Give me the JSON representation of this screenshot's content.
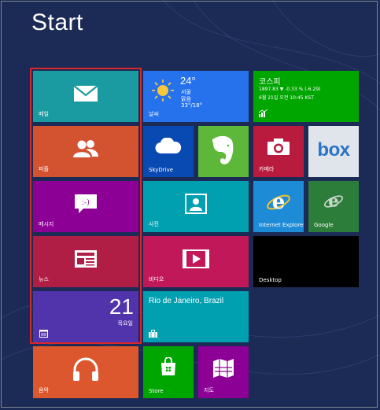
{
  "screen": {
    "title": "Start"
  },
  "tiles": {
    "mail": {
      "label": "메일",
      "color": "#1a9ba1"
    },
    "people": {
      "label": "피플",
      "color": "#d35230"
    },
    "messaging": {
      "label": "메시지",
      "color": "#8c0095"
    },
    "news": {
      "label": "뉴스",
      "color": "#b01e45"
    },
    "calendar": {
      "label_icon": "calendar-icon",
      "day_number": "21",
      "weekday": "목요일",
      "color": "#5133ab"
    },
    "weather": {
      "label": "날씨",
      "temperature": "24°",
      "city": "서울",
      "condition": "맑음",
      "range": "33°/18°",
      "color": "#2672ec"
    },
    "finance": {
      "title": "코스피",
      "line1": "1897.83 ▼ -0.33 % (-6.29)",
      "line2": "6월 21일 오전 10:45 KST",
      "color": "#00a600"
    },
    "skydrive": {
      "label": "SkyDrive",
      "color": "#094ab2"
    },
    "evernote": {
      "color": "#5db839"
    },
    "camera": {
      "label": "카메라",
      "color": "#b81b3e"
    },
    "box": {
      "label": "box",
      "color": "#dfe5eb"
    },
    "photos": {
      "label": "사진",
      "color": "#00a0b1"
    },
    "ie": {
      "label": "Internet Explorer",
      "color": "#1e8bd6"
    },
    "google": {
      "label": "Google",
      "color": "#2d7d3a"
    },
    "video": {
      "label": "비디오",
      "color": "#c1185a"
    },
    "desktop": {
      "label": "Desktop",
      "color": "#000000"
    },
    "travel": {
      "title": "Rio de Janeiro, Brazil",
      "color": "#00a0b1"
    },
    "music": {
      "label": "음악",
      "color": "#dc572e"
    },
    "store": {
      "label": "Store",
      "color": "#00a600"
    },
    "maps": {
      "label": "지도",
      "color": "#8c0095"
    }
  }
}
